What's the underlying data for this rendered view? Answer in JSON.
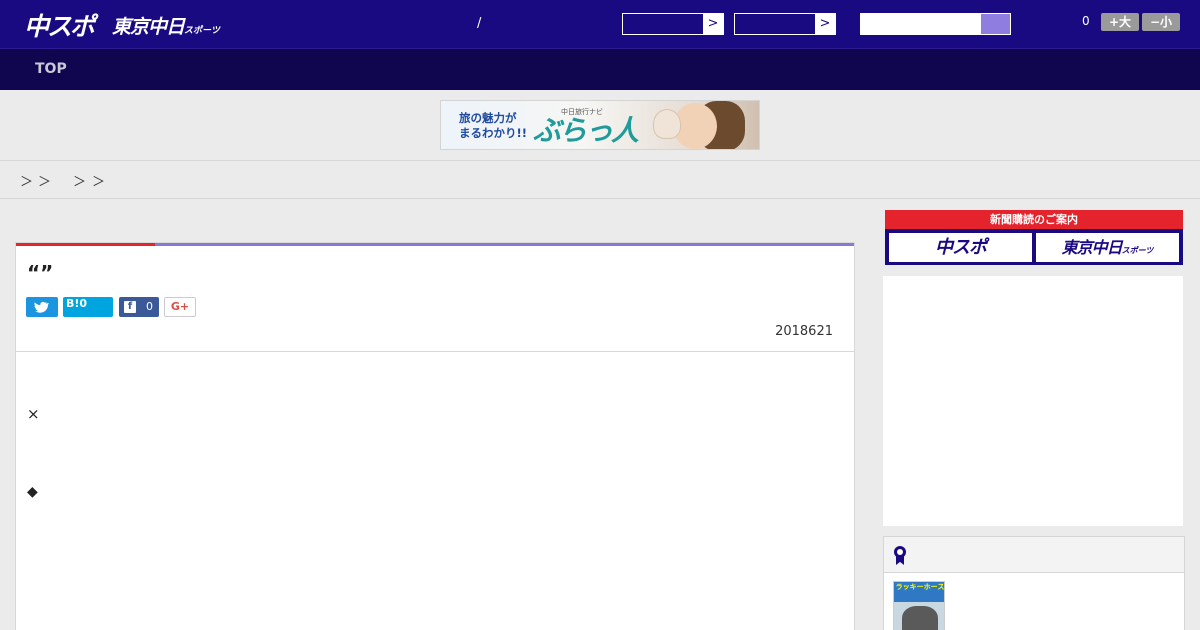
{
  "header": {
    "logo_main": "中スポ",
    "logo_sub": "東京中日",
    "logo_sub_small": "スポーツ",
    "slash": "/",
    "select1_arrow": ">",
    "select2_arrow": ">",
    "counter": "0",
    "font_larger": "+大",
    "font_smaller": "−小",
    "colors": {
      "topbar": "#1a0a82",
      "navbar": "#10064f",
      "accent_red": "#e4232c",
      "accent_purple": "#8a79d4"
    }
  },
  "nav": {
    "items": [
      "TOP"
    ]
  },
  "banner": {
    "tagline_line1": "旅の魅力が",
    "tagline_line2": "まるわかり!!",
    "brand_small": "中日旅行ナビ",
    "brand": "ぶらっ人"
  },
  "breadcrumb": {
    "sep1": "＞",
    "sep2": "＞",
    "sep3": "＞",
    "sep4": "＞"
  },
  "article": {
    "title": "“”",
    "share": {
      "hatena_label": "B!",
      "hatena_count": "0",
      "facebook_count": "0",
      "gplus_label": "G+"
    },
    "date": "2018621",
    "body_char1": "×",
    "body_char2": "◆"
  },
  "sidebar": {
    "subscribe_header": "新聞購読のご案内",
    "subscribe_btn1": "中スポ",
    "subscribe_btn2": "東京中日",
    "subscribe_btn2_small": "スポーツ",
    "thumb_text": "ラッキーホース"
  }
}
